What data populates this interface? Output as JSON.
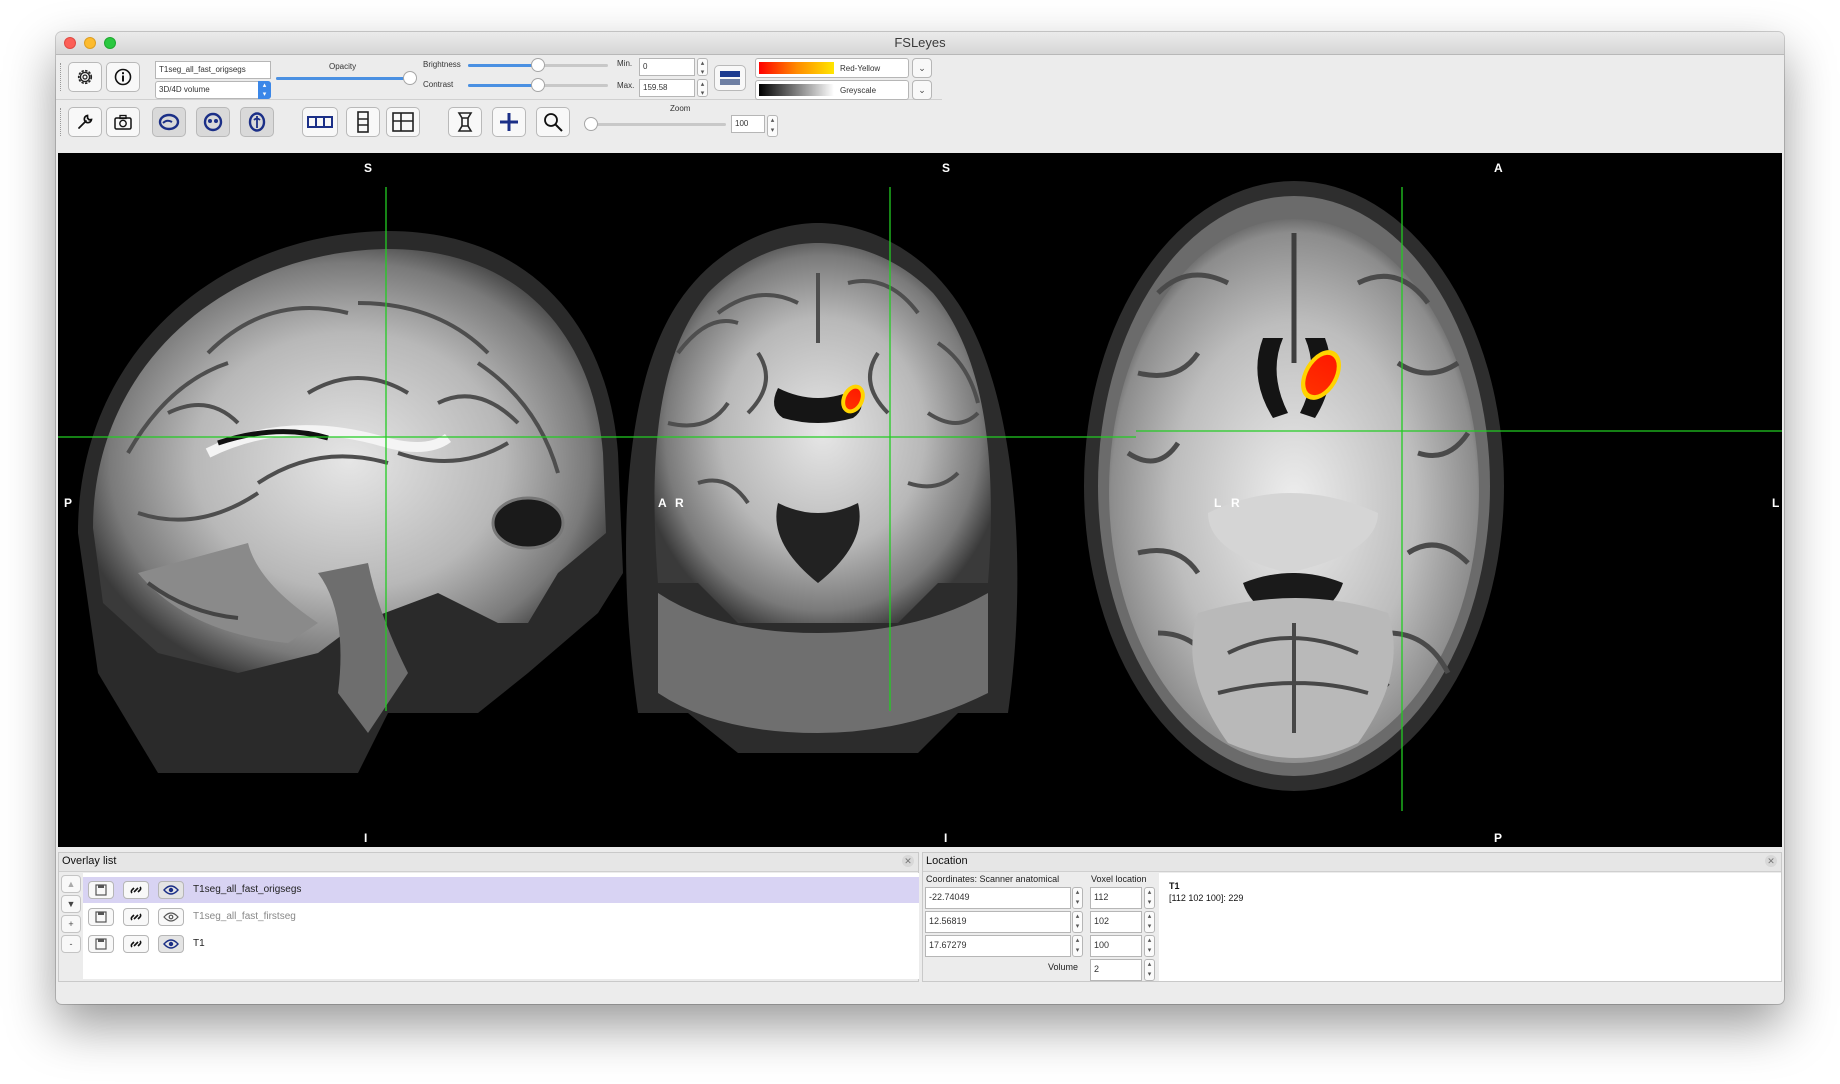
{
  "window": {
    "title": "FSLeyes"
  },
  "toolbar": {
    "overlay_name": "T1seg_all_fast_origsegs",
    "overlay_type": "3D/4D volume",
    "opacity_label": "Opacity",
    "opacity_value": 0.95,
    "brightness_label": "Brightness",
    "brightness_value": 0.5,
    "contrast_label": "Contrast",
    "contrast_value": 0.5,
    "min_label": "Min.",
    "min_value": "0",
    "max_label": "Max.",
    "max_value": "159.58",
    "cmap_primary": "Red-Yellow",
    "cmap_secondary": "Greyscale",
    "zoom_label": "Zoom",
    "zoom_value": "100"
  },
  "views": {
    "sagittal": {
      "top": "S",
      "bottom": "I",
      "left": "P",
      "right": "A"
    },
    "coronal": {
      "top": "S",
      "bottom": "I",
      "left": "R",
      "right": "L"
    },
    "axial": {
      "top": "A",
      "bottom": "P",
      "left": "R",
      "right": "L"
    }
  },
  "overlay_list": {
    "title": "Overlay list",
    "items": [
      {
        "name": "T1seg_all_fast_origsegs",
        "visible": true,
        "selected": true
      },
      {
        "name": "T1seg_all_fast_firstseg",
        "visible": false,
        "selected": false
      },
      {
        "name": "T1",
        "visible": true,
        "selected": false
      }
    ]
  },
  "location": {
    "title": "Location",
    "coords_label": "Coordinates: Scanner anatomical",
    "voxel_label": "Voxel location",
    "coords": [
      "-22.74049",
      "12.56819",
      "17.67279"
    ],
    "voxels": [
      "112",
      "102",
      "100"
    ],
    "volume_label": "Volume",
    "volume_value": "2",
    "info_name": "T1",
    "info_value": "[112 102 100]: 229"
  },
  "colors": {
    "crosshair": "#22cc22",
    "overlay_red": "#ff1a00",
    "overlay_yellow": "#ffd400",
    "accent": "#4a90e2"
  }
}
